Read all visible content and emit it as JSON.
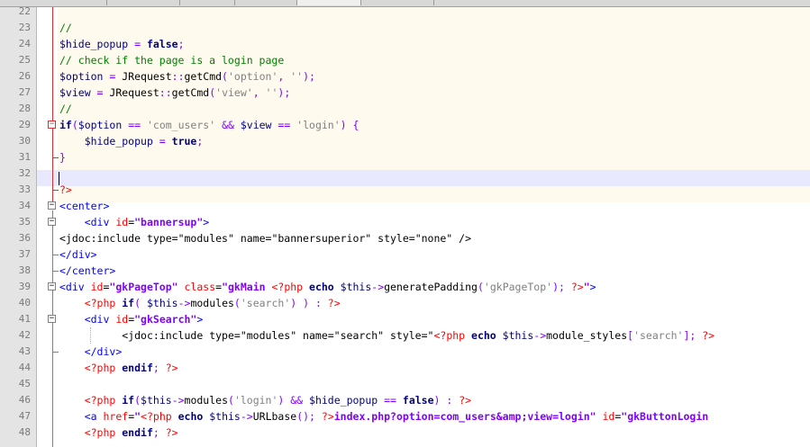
{
  "colors": {
    "comment": "#008000",
    "variable": "#000080",
    "keyword": "#000080",
    "string": "#808080",
    "operator": "#8000ff",
    "php_delimiter": "#ff0000",
    "html_tag": "#0000ff",
    "html_attribute": "#ff0000",
    "html_attribute_value": "#8000ff",
    "php_block_background": "#fefaee",
    "current_line_background": "#e8e8ff"
  },
  "editor": {
    "current_line": "32",
    "lines": [
      {
        "number": "22",
        "fold": "",
        "tokens": []
      },
      {
        "number": "23",
        "fold": "",
        "tokens": [
          {
            "t": "//",
            "c": "comment"
          }
        ]
      },
      {
        "number": "24",
        "fold": "",
        "tokens": [
          {
            "t": "$hide_popup",
            "c": "var"
          },
          {
            "t": " = ",
            "c": "op"
          },
          {
            "t": "false",
            "c": "kw"
          },
          {
            "t": ";",
            "c": "op"
          }
        ]
      },
      {
        "number": "25",
        "fold": "",
        "tokens": [
          {
            "t": "// check if the page is a login page",
            "c": "comment"
          }
        ]
      },
      {
        "number": "26",
        "fold": "",
        "tokens": [
          {
            "t": "$option",
            "c": "var"
          },
          {
            "t": " = ",
            "c": "op"
          },
          {
            "t": "JRequest",
            "c": "plain"
          },
          {
            "t": "::",
            "c": "op"
          },
          {
            "t": "getCmd",
            "c": "plain"
          },
          {
            "t": "(",
            "c": "op"
          },
          {
            "t": "'option'",
            "c": "str"
          },
          {
            "t": ", ",
            "c": "op"
          },
          {
            "t": "''",
            "c": "str"
          },
          {
            "t": ");",
            "c": "op"
          }
        ]
      },
      {
        "number": "27",
        "fold": "",
        "tokens": [
          {
            "t": "$view",
            "c": "var"
          },
          {
            "t": " = ",
            "c": "op"
          },
          {
            "t": "JRequest",
            "c": "plain"
          },
          {
            "t": "::",
            "c": "op"
          },
          {
            "t": "getCmd",
            "c": "plain"
          },
          {
            "t": "(",
            "c": "op"
          },
          {
            "t": "'view'",
            "c": "str"
          },
          {
            "t": ", ",
            "c": "op"
          },
          {
            "t": "''",
            "c": "str"
          },
          {
            "t": ");",
            "c": "op"
          }
        ]
      },
      {
        "number": "28",
        "fold": "",
        "tokens": [
          {
            "t": "//",
            "c": "comment"
          }
        ]
      },
      {
        "number": "29",
        "fold": "php-open",
        "tokens": [
          {
            "t": "if",
            "c": "kw"
          },
          {
            "t": "(",
            "c": "op"
          },
          {
            "t": "$option",
            "c": "var"
          },
          {
            "t": " == ",
            "c": "op"
          },
          {
            "t": "'com_users'",
            "c": "str"
          },
          {
            "t": " && ",
            "c": "op"
          },
          {
            "t": "$view",
            "c": "var"
          },
          {
            "t": " == ",
            "c": "op"
          },
          {
            "t": "'login'",
            "c": "str"
          },
          {
            "t": ") {",
            "c": "op"
          }
        ]
      },
      {
        "number": "30",
        "fold": "",
        "tokens": [
          {
            "t": "    ",
            "c": "plain"
          },
          {
            "t": "$hide_popup",
            "c": "var"
          },
          {
            "t": " = ",
            "c": "op"
          },
          {
            "t": "true",
            "c": "kw"
          },
          {
            "t": ";",
            "c": "op"
          }
        ]
      },
      {
        "number": "31",
        "fold": "php-end",
        "tokens": [
          {
            "t": "}",
            "c": "op"
          }
        ]
      },
      {
        "number": "32",
        "fold": "",
        "tokens": []
      },
      {
        "number": "33",
        "fold": "php-end",
        "tokens": [
          {
            "t": "?>",
            "c": "phpdelim"
          }
        ]
      },
      {
        "number": "34",
        "fold": "open",
        "tokens": [
          {
            "t": "<center>",
            "c": "tag"
          }
        ]
      },
      {
        "number": "35",
        "fold": "open",
        "tokens": [
          {
            "t": "    ",
            "c": "plain"
          },
          {
            "t": "<div ",
            "c": "tag"
          },
          {
            "t": "id",
            "c": "attr"
          },
          {
            "t": "=",
            "c": "plain"
          },
          {
            "t": "\"bannersup\"",
            "c": "attrval"
          },
          {
            "t": ">",
            "c": "tag"
          }
        ]
      },
      {
        "number": "36",
        "fold": "",
        "tokens": [
          {
            "t": "<jdoc:include ",
            "c": "plain"
          },
          {
            "t": "type",
            "c": "plain"
          },
          {
            "t": "=",
            "c": "plain"
          },
          {
            "t": "\"modules\"",
            "c": "plain"
          },
          {
            "t": " name=",
            "c": "plain"
          },
          {
            "t": "\"bannersuperior\"",
            "c": "plain"
          },
          {
            "t": " style=",
            "c": "plain"
          },
          {
            "t": "\"none\"",
            "c": "plain"
          },
          {
            "t": " />",
            "c": "plain"
          }
        ]
      },
      {
        "number": "37",
        "fold": "end",
        "tokens": [
          {
            "t": "</div>",
            "c": "tag"
          }
        ]
      },
      {
        "number": "38",
        "fold": "end",
        "tokens": [
          {
            "t": "</center>",
            "c": "tag"
          }
        ]
      },
      {
        "number": "39",
        "fold": "open",
        "tokens": [
          {
            "t": "<div ",
            "c": "tag"
          },
          {
            "t": "id",
            "c": "attr"
          },
          {
            "t": "=",
            "c": "plain"
          },
          {
            "t": "\"gkPageTop\"",
            "c": "attrval"
          },
          {
            "t": " class",
            "c": "attr"
          },
          {
            "t": "=",
            "c": "plain"
          },
          {
            "t": "\"gkMain ",
            "c": "attrval"
          },
          {
            "t": "<?php ",
            "c": "phpdelim"
          },
          {
            "t": "echo ",
            "c": "kw"
          },
          {
            "t": "$this",
            "c": "var"
          },
          {
            "t": "->",
            "c": "op"
          },
          {
            "t": "generatePadding",
            "c": "plain"
          },
          {
            "t": "(",
            "c": "op"
          },
          {
            "t": "'gkPageTop'",
            "c": "str"
          },
          {
            "t": "); ",
            "c": "op"
          },
          {
            "t": "?>",
            "c": "phpdelim"
          },
          {
            "t": "\"",
            "c": "attrval"
          },
          {
            "t": ">",
            "c": "tag"
          }
        ]
      },
      {
        "number": "40",
        "fold": "",
        "tokens": [
          {
            "t": "    ",
            "c": "plain"
          },
          {
            "t": "<?php ",
            "c": "phpdelim"
          },
          {
            "t": "if",
            "c": "kw"
          },
          {
            "t": "( ",
            "c": "op"
          },
          {
            "t": "$this",
            "c": "var"
          },
          {
            "t": "->",
            "c": "op"
          },
          {
            "t": "modules",
            "c": "plain"
          },
          {
            "t": "(",
            "c": "op"
          },
          {
            "t": "'search'",
            "c": "str"
          },
          {
            "t": ") ) : ",
            "c": "op"
          },
          {
            "t": "?>",
            "c": "phpdelim"
          }
        ]
      },
      {
        "number": "41",
        "fold": "open",
        "tokens": [
          {
            "t": "    ",
            "c": "plain"
          },
          {
            "t": "<div ",
            "c": "tag"
          },
          {
            "t": "id",
            "c": "attr"
          },
          {
            "t": "=",
            "c": "plain"
          },
          {
            "t": "\"gkSearch\"",
            "c": "attrval"
          },
          {
            "t": ">",
            "c": "tag"
          }
        ]
      },
      {
        "number": "42",
        "fold": "",
        "tokens": [
          {
            "t": "          ",
            "c": "plain"
          },
          {
            "t": "<jdoc:include ",
            "c": "plain"
          },
          {
            "t": "type=",
            "c": "plain"
          },
          {
            "t": "\"modules\"",
            "c": "plain"
          },
          {
            "t": " name=",
            "c": "plain"
          },
          {
            "t": "\"search\"",
            "c": "plain"
          },
          {
            "t": " style=",
            "c": "plain"
          },
          {
            "t": "\"",
            "c": "plain"
          },
          {
            "t": "<?php ",
            "c": "phpdelim"
          },
          {
            "t": "echo ",
            "c": "kw"
          },
          {
            "t": "$this",
            "c": "var"
          },
          {
            "t": "->",
            "c": "op"
          },
          {
            "t": "module_styles",
            "c": "plain"
          },
          {
            "t": "[",
            "c": "op"
          },
          {
            "t": "'search'",
            "c": "str"
          },
          {
            "t": "]; ",
            "c": "op"
          },
          {
            "t": "?>",
            "c": "phpdelim"
          }
        ]
      },
      {
        "number": "43",
        "fold": "end",
        "tokens": [
          {
            "t": "    ",
            "c": "plain"
          },
          {
            "t": "</div>",
            "c": "tag"
          }
        ]
      },
      {
        "number": "44",
        "fold": "",
        "tokens": [
          {
            "t": "    ",
            "c": "plain"
          },
          {
            "t": "<?php ",
            "c": "phpdelim"
          },
          {
            "t": "endif",
            "c": "kw"
          },
          {
            "t": "; ",
            "c": "op"
          },
          {
            "t": "?>",
            "c": "phpdelim"
          }
        ]
      },
      {
        "number": "45",
        "fold": "",
        "tokens": []
      },
      {
        "number": "46",
        "fold": "",
        "tokens": [
          {
            "t": "    ",
            "c": "plain"
          },
          {
            "t": "<?php ",
            "c": "phpdelim"
          },
          {
            "t": "if",
            "c": "kw"
          },
          {
            "t": "(",
            "c": "op"
          },
          {
            "t": "$this",
            "c": "var"
          },
          {
            "t": "->",
            "c": "op"
          },
          {
            "t": "modules",
            "c": "plain"
          },
          {
            "t": "(",
            "c": "op"
          },
          {
            "t": "'login'",
            "c": "str"
          },
          {
            "t": ") && ",
            "c": "op"
          },
          {
            "t": "$hide_popup",
            "c": "var"
          },
          {
            "t": " == ",
            "c": "op"
          },
          {
            "t": "false",
            "c": "kw"
          },
          {
            "t": ") : ",
            "c": "op"
          },
          {
            "t": "?>",
            "c": "phpdelim"
          }
        ]
      },
      {
        "number": "47",
        "fold": "",
        "tokens": [
          {
            "t": "    ",
            "c": "plain"
          },
          {
            "t": "<a ",
            "c": "tag"
          },
          {
            "t": "href",
            "c": "attr"
          },
          {
            "t": "=",
            "c": "plain"
          },
          {
            "t": "\"",
            "c": "attrval"
          },
          {
            "t": "<?php ",
            "c": "phpdelim"
          },
          {
            "t": "echo ",
            "c": "kw"
          },
          {
            "t": "$this",
            "c": "var"
          },
          {
            "t": "->",
            "c": "op"
          },
          {
            "t": "URLbase",
            "c": "plain"
          },
          {
            "t": "(); ",
            "c": "op"
          },
          {
            "t": "?>",
            "c": "phpdelim"
          },
          {
            "t": "index.php?option=com_users&amp;view=login\"",
            "c": "attrval"
          },
          {
            "t": " id",
            "c": "attr"
          },
          {
            "t": "=",
            "c": "plain"
          },
          {
            "t": "\"gkButtonLogin",
            "c": "attrval"
          }
        ]
      },
      {
        "number": "48",
        "fold": "",
        "tokens": [
          {
            "t": "    ",
            "c": "plain"
          },
          {
            "t": "<?php ",
            "c": "phpdelim"
          },
          {
            "t": "endif",
            "c": "kw"
          },
          {
            "t": "; ",
            "c": "op"
          },
          {
            "t": "?>",
            "c": "phpdelim"
          }
        ]
      }
    ]
  }
}
